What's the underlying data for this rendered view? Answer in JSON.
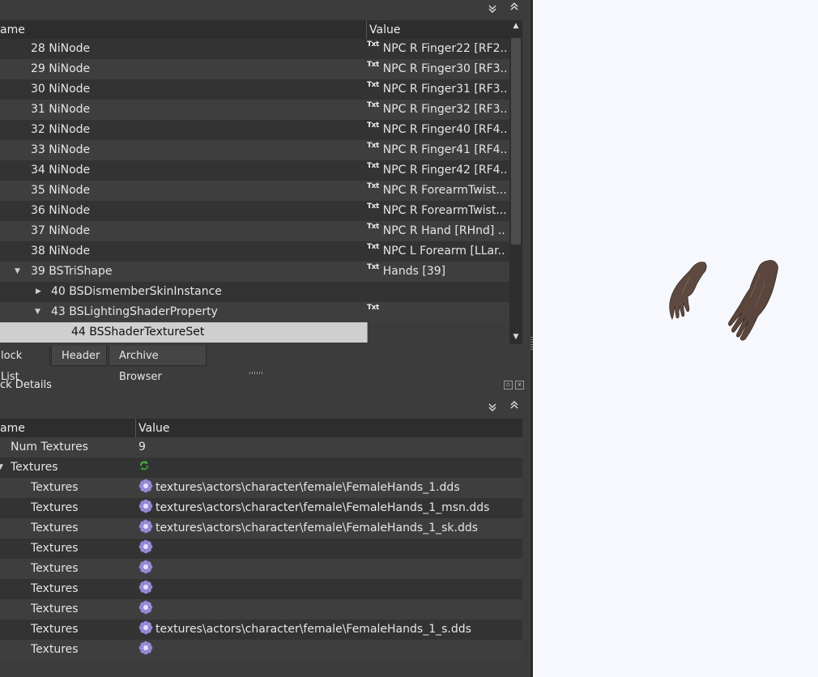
{
  "block_list": {
    "columns": {
      "name": "ame",
      "value": "Value"
    },
    "rows": [
      {
        "name": "28 NiNode",
        "value": "NPC R Finger22 [RF2..."
      },
      {
        "name": "29 NiNode",
        "value": "NPC R Finger30 [RF3..."
      },
      {
        "name": "30 NiNode",
        "value": "NPC R Finger31 [RF3..."
      },
      {
        "name": "31 NiNode",
        "value": "NPC R Finger32 [RF3..."
      },
      {
        "name": "32 NiNode",
        "value": "NPC R Finger40 [RF4..."
      },
      {
        "name": "33 NiNode",
        "value": "NPC R Finger41 [RF4..."
      },
      {
        "name": "34 NiNode",
        "value": "NPC R Finger42 [RF4..."
      },
      {
        "name": "35 NiNode",
        "value": "NPC R ForearmTwist..."
      },
      {
        "name": "36 NiNode",
        "value": "NPC R ForearmTwist..."
      },
      {
        "name": "37 NiNode",
        "value": "NPC R Hand [RHnd] ..."
      },
      {
        "name": "38 NiNode",
        "value": "NPC L Forearm [LLar..."
      },
      {
        "name": "39 BSTriShape",
        "value": "Hands [39]"
      },
      {
        "name": "40 BSDismemberSkinInstance",
        "value": ""
      },
      {
        "name": "43 BSLightingShaderProperty",
        "value": ""
      },
      {
        "name": "44 BSShaderTextureSet",
        "value": ""
      }
    ],
    "txt_icon": "Txt"
  },
  "tabs": [
    {
      "label": "lock List"
    },
    {
      "label": "Header"
    },
    {
      "label": "Archive Browser"
    }
  ],
  "block_details": {
    "title": "ck Details",
    "columns": {
      "name": "ame",
      "value": "Value"
    },
    "rows": [
      {
        "name": "Num Textures",
        "value": "9"
      },
      {
        "name": "Textures",
        "value": ""
      },
      {
        "name": "Textures",
        "value": "textures\\actors\\character\\female\\FemaleHands_1.dds"
      },
      {
        "name": "Textures",
        "value": "textures\\actors\\character\\female\\FemaleHands_1_msn.dds"
      },
      {
        "name": "Textures",
        "value": "textures\\actors\\character\\female\\FemaleHands_1_sk.dds"
      },
      {
        "name": "Textures",
        "value": ""
      },
      {
        "name": "Textures",
        "value": ""
      },
      {
        "name": "Textures",
        "value": ""
      },
      {
        "name": "Textures",
        "value": ""
      },
      {
        "name": "Textures",
        "value": "textures\\actors\\character\\female\\FemaleHands_1_s.dds"
      },
      {
        "name": "Textures",
        "value": ""
      }
    ]
  },
  "icons": {
    "expand_all": "double-chevron-down-icon",
    "collapse_all": "double-chevron-up-icon",
    "texture": "texture-flower-icon",
    "refresh": "recycle-icon",
    "float": "float-window-icon",
    "close": "close-window-icon"
  },
  "colors": {
    "panel": "#3c3c3c",
    "row_dark": "#333333",
    "row_light": "#3e3e3e",
    "selected": "#cfcfcf",
    "viewport_bg": "#f7f8fd"
  }
}
